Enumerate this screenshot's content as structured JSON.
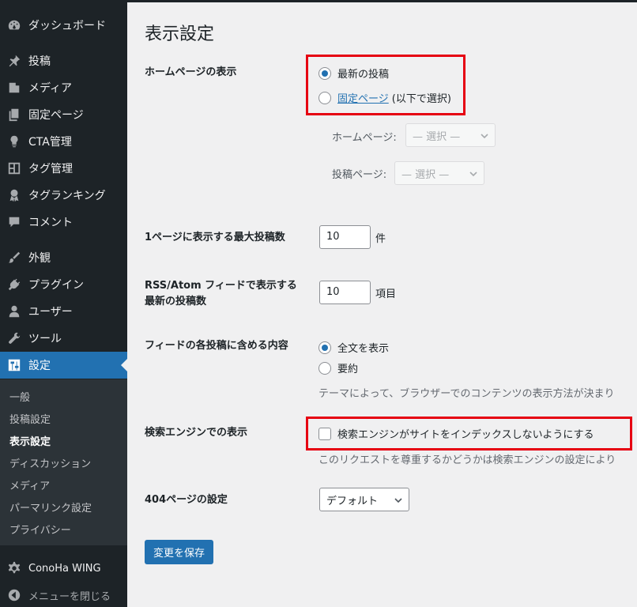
{
  "sidebar": {
    "items": [
      {
        "label": "ダッシュボード",
        "icon": "dashboard-icon"
      },
      {
        "label": "投稿",
        "icon": "pin-icon"
      },
      {
        "label": "メディア",
        "icon": "media-icon"
      },
      {
        "label": "固定ページ",
        "icon": "pages-icon"
      },
      {
        "label": "CTA管理",
        "icon": "lightbulb-icon"
      },
      {
        "label": "タグ管理",
        "icon": "layout-icon"
      },
      {
        "label": "タグランキング",
        "icon": "award-icon"
      },
      {
        "label": "コメント",
        "icon": "comment-icon"
      },
      {
        "label": "外観",
        "icon": "brush-icon"
      },
      {
        "label": "プラグイン",
        "icon": "plugin-icon"
      },
      {
        "label": "ユーザー",
        "icon": "user-icon"
      },
      {
        "label": "ツール",
        "icon": "wrench-icon"
      },
      {
        "label": "設定",
        "icon": "settings-icon"
      }
    ],
    "submenu": [
      "一般",
      "投稿設定",
      "表示設定",
      "ディスカッション",
      "メディア",
      "パーマリンク設定",
      "プライバシー"
    ],
    "conoha": {
      "label": "ConoHa WING",
      "icon": "gear-icon"
    },
    "collapse": {
      "label": "メニューを閉じる",
      "icon": "collapse-icon"
    }
  },
  "page": {
    "title": "表示設定",
    "homepage": {
      "label": "ホームページの表示",
      "opt_latest": "最新の投稿",
      "opt_static_link": "固定ページ",
      "opt_static_suffix": "(以下で選択)",
      "homepage_label": "ホームページ:",
      "homepage_select": "— 選択 —",
      "posts_label": "投稿ページ:",
      "posts_select": "— 選択 —"
    },
    "per_page": {
      "label": "1ページに表示する最大投稿数",
      "value": "10",
      "unit": "件"
    },
    "rss": {
      "label_line1": "RSS/Atom フィードで表示する",
      "label_line2": "最新の投稿数",
      "value": "10",
      "unit": "項目"
    },
    "feed": {
      "label": "フィードの各投稿に含める内容",
      "opt_full": "全文を表示",
      "opt_summary": "要約",
      "desc": "テーマによって、ブラウザーでのコンテンツの表示方法が決まり"
    },
    "search": {
      "label": "検索エンジンでの表示",
      "checkbox": "検索エンジンがサイトをインデックスしないようにする",
      "desc": "このリクエストを尊重するかどうかは検索エンジンの設定により"
    },
    "page404": {
      "label": "404ページの設定",
      "select": "デフォルト"
    },
    "save_button": "変更を保存"
  },
  "colors": {
    "sidebar": "#1d2327",
    "submenu": "#2c3338",
    "accent": "#2271b1",
    "highlight": "#e60012"
  }
}
